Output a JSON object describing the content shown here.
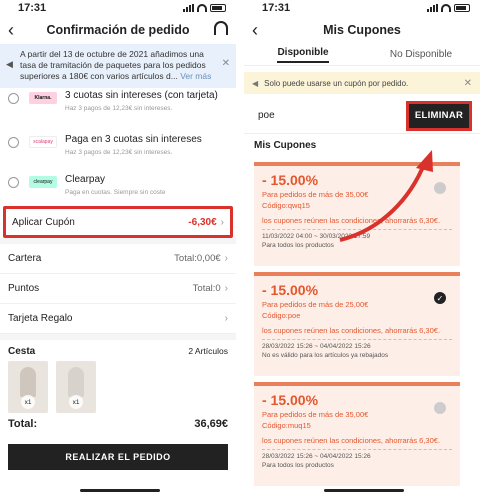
{
  "left": {
    "status_time": "17:31",
    "title": "Confirmación de pedido",
    "notice": {
      "text": "A partir del 13 de octubre de 2021 añadimos una tasa de tramitación de paquetes para los pedidos superiores a 180€ con varios artículos d...",
      "more": "Ver más"
    },
    "payments": [
      {
        "logo": "Klarna.",
        "title": "3 cuotas sin intereses (con tarjeta)",
        "sub": "Haz 3 pagos de 12,23€ sin intereses."
      },
      {
        "logo": "scalapay",
        "title": "Paga en 3 cuotas sin intereses",
        "sub": "Haz 3 pagos de 12,23€ sin intereses."
      },
      {
        "logo": "clearpay",
        "title": "Clearpay",
        "sub": "Paga en cuotas. Siempre sin coste"
      }
    ],
    "coupon": {
      "label": "Aplicar Cupón",
      "amount": "-6,30€"
    },
    "rows": [
      {
        "label": "Cartera",
        "value": "Total:0,00€"
      },
      {
        "label": "Puntos",
        "value": "Total:0"
      },
      {
        "label": "Tarjeta Regalo",
        "value": ""
      }
    ],
    "cart": {
      "title": "Cesta",
      "count": "2 Artículos",
      "qty1": "x1",
      "qty2": "x1"
    },
    "total": {
      "label": "Total:",
      "value": "36,69€"
    },
    "order_button": "REALIZAR EL PEDIDO"
  },
  "right": {
    "status_time": "17:31",
    "title": "Mis Cupones",
    "tabs": [
      "Disponible",
      "No Disponible"
    ],
    "notice": "Solo puede usarse un cupón por pedido.",
    "code": "poe",
    "remove_button": "ELIMINAR",
    "section": "Mis Cupones",
    "coupons": [
      {
        "pct": "- 15.00%",
        "min": "Para pedidos de más de 35,00€",
        "code": "Código:qwq15",
        "cond": "los cupones reúnen las condiciones, ahorrarás 6,30€.",
        "date": "11/03/2022 04:00 ~ 30/03/2022 17:59",
        "note": "Para todos los productos"
      },
      {
        "pct": "- 15.00%",
        "min": "Para pedidos de más de 25,00€",
        "code": "Código:poe",
        "cond": "los cupones reúnen las condiciones, ahorrarás 6,30€.",
        "date": "28/03/2022 15:26 ~ 04/04/2022 15:26",
        "note": "No es válido para los artículos ya rebajados"
      },
      {
        "pct": "- 15.00%",
        "min": "Para pedidos de más de 35,00€",
        "code": "Código:muq15",
        "cond": "los cupones reúnen las condiciones, ahorrarás 6,30€.",
        "date": "28/03/2022 15:26 ~ 04/04/2022 15:26",
        "note": "Para todos los productos"
      }
    ]
  },
  "colors": {
    "accent_red": "#d9312b",
    "coupon_orange": "#e4572e"
  }
}
